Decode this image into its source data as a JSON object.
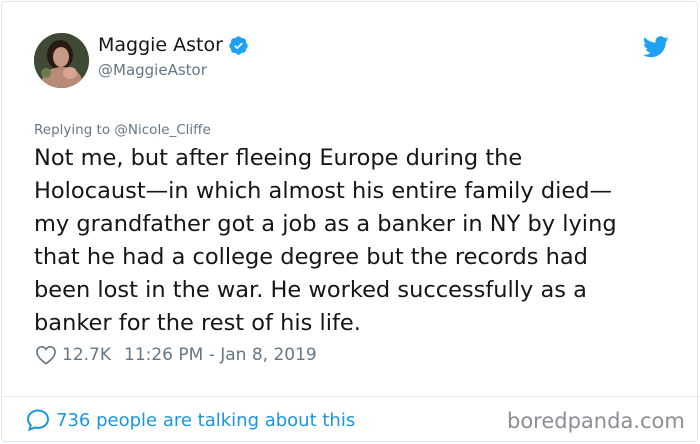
{
  "author": {
    "name": "Maggie Astor",
    "handle": "@MaggieAstor",
    "verified": true
  },
  "reply": {
    "prefix": "Replying to ",
    "mention": "@Nicole_Cliffe"
  },
  "tweet": {
    "lines": [
      "Not me, but after fleeing Europe during the",
      "Holocaust—in which almost his entire family died—",
      "my grandfather got a job as a banker in NY by lying",
      "that he had a college degree but the records had",
      "been lost in the war. He worked successfully as a",
      "banker for the rest of his life."
    ],
    "likes": "12.7K",
    "timestamp": "11:26 PM - Jan 8, 2019"
  },
  "footer": {
    "talking": "736 people are talking about this",
    "watermark": "boredpanda.com"
  },
  "icons": {
    "verified": "verified-badge-icon",
    "bird": "twitter-bird-icon",
    "heart": "heart-icon",
    "bubble": "speech-bubble-icon"
  },
  "colors": {
    "twitter_blue": "#1da1f2",
    "link_blue": "#1b95e0",
    "text": "#14171a",
    "secondary": "#657786"
  }
}
